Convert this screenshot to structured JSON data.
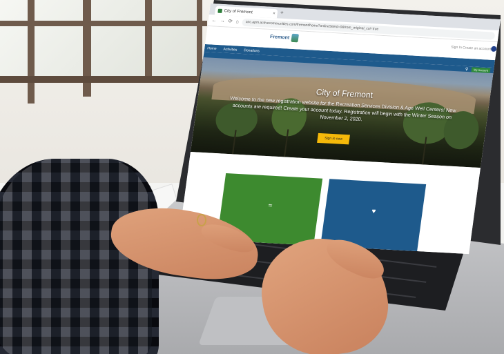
{
  "browser": {
    "tab_title": "City of Fremont",
    "tab_close": "×",
    "new_tab": "+",
    "back": "←",
    "forward": "→",
    "reload": "⟳",
    "home": "⌂",
    "url": "anc.apm.activecommunities.com/fremont/home?onlineSiteId=0&from_original_cui=true"
  },
  "site": {
    "logo_text": "Fremont",
    "header_links": "Sign In  Create an account",
    "nav": [
      "Home",
      "Activities",
      "Donations"
    ],
    "hero": {
      "title": "City of Fremont",
      "welcome": "Welcome to the new registration website for the Recreation Services Division & Age Well Centers! New accounts are required! Create your account today. Registration will begin with the Winter Season on November 2, 2020.",
      "sign_in_button": "Sign in now",
      "my_account": "My Account"
    }
  },
  "icons": {
    "search": "search-icon",
    "swimmer": "swimmer-icon",
    "heart": "heart-icon"
  },
  "colors": {
    "nav_blue": "#1e5a8c",
    "button_yellow": "#f5b90a",
    "card_green": "#3d8a2f",
    "card_blue": "#1e5a8c"
  }
}
